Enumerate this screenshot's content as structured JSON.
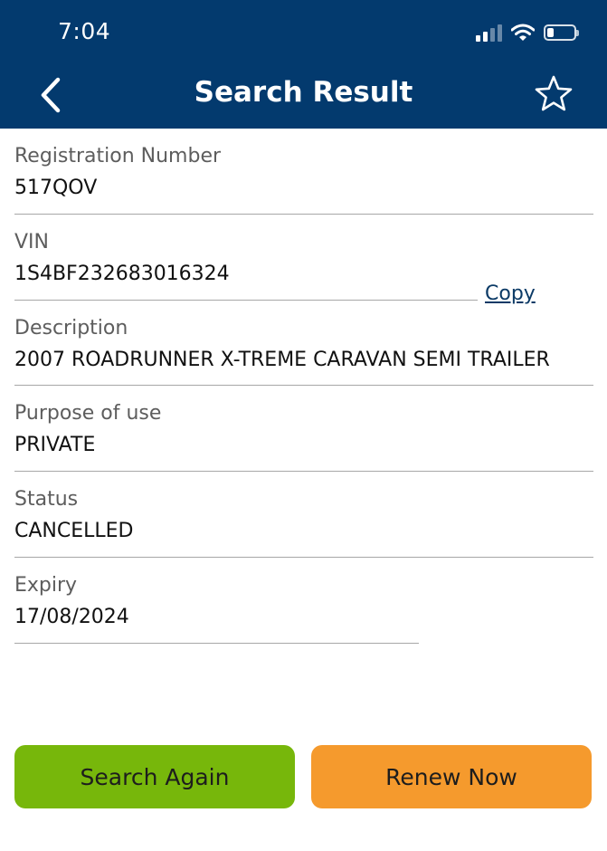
{
  "status_bar": {
    "time": "7:04"
  },
  "header": {
    "title": "Search Result"
  },
  "vin_copy_label": "Copy",
  "fields": [
    {
      "label": "Registration Number",
      "value": "517QOV"
    },
    {
      "label": "VIN",
      "value": "1S4BF232683016324"
    },
    {
      "label": "Description",
      "value": "2007 ROADRUNNER X-TREME CARAVAN SEMI TRAILER"
    },
    {
      "label": "Purpose of use",
      "value": "PRIVATE"
    },
    {
      "label": "Status",
      "value": "CANCELLED"
    },
    {
      "label": "Expiry",
      "value": "17/08/2024"
    }
  ],
  "actions": {
    "search_again": "Search Again",
    "renew_now": "Renew Now"
  },
  "colors": {
    "header": "#033a6e",
    "search_again": "#77b70b",
    "renew_now": "#f59a2d",
    "link": "#0b3a66"
  },
  "icons": {
    "back": "chevron-left-icon",
    "favorite": "star-outline-icon",
    "signal": "cellular-signal-icon",
    "wifi": "wifi-icon",
    "battery": "battery-icon"
  },
  "battery_level": 0.25
}
